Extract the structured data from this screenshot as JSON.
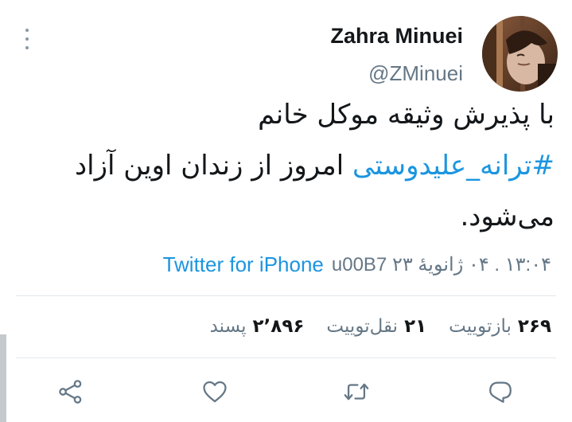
{
  "tweet": {
    "author": {
      "display_name": "Zahra Minuei",
      "handle": "@ZMinuei"
    },
    "text": {
      "line1": "با پذیرش وثیقه موکل خانم",
      "hashtag": "#ترانه_علیدوستی",
      "line2_rest": " امروز از زندان اوین آزاد",
      "line3": "می‌شود."
    },
    "meta": {
      "timestamp": "۱۳:۰۴ . ۰۴ ژانویهٔ ۲۳ u00B7",
      "source": "Twitter for iPhone"
    },
    "stats": [
      {
        "num": "۲۶۹",
        "label": "بازتوییت"
      },
      {
        "num": "۲۱",
        "label": "نقل‌توییت"
      },
      {
        "num": "۲٬۸۹۶",
        "label": "پسند"
      }
    ]
  },
  "actions": {
    "reply_icon": "reply-icon",
    "retweet_icon": "retweet-icon",
    "like_icon": "heart-icon",
    "share_icon": "share-icon"
  },
  "colors": {
    "link": "#1b95e0",
    "secondary_text": "#657786",
    "icon": "#657786",
    "divider": "#e1e8ed"
  }
}
